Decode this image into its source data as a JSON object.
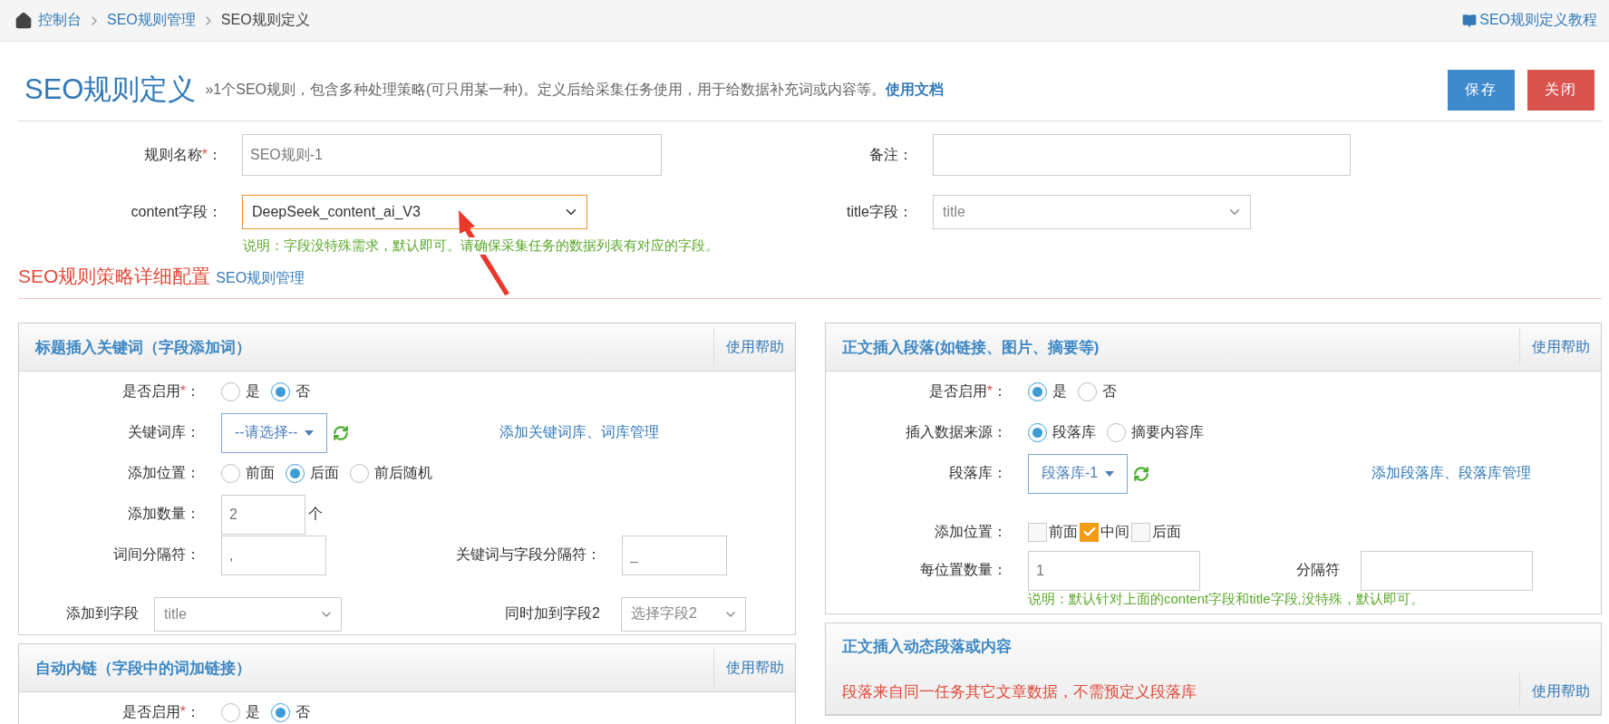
{
  "breadcrumb": {
    "items": [
      {
        "label": "控制台",
        "kind": "home"
      },
      {
        "label": "SEO规则管理",
        "kind": "link"
      },
      {
        "label": "SEO规则定义",
        "kind": "current"
      }
    ],
    "tutorial": "SEO规则定义教程"
  },
  "header": {
    "title": "SEO规则定义",
    "description": "»1个SEO规则，包含多种处理策略(可只用某一种)。定义后给采集任务使用，用于给数据补充词或内容等。",
    "doc_link": "使用文档",
    "buttons": [
      {
        "label": "保存",
        "kind": "primary"
      },
      {
        "label": "关闭",
        "kind": "danger"
      }
    ]
  },
  "form": {
    "rows": [
      [
        {
          "label": "规则名称",
          "star": "*",
          "after": "：",
          "kind": "input",
          "value": "SEO规则-1"
        },
        {
          "label": "备注：",
          "kind": "input"
        }
      ],
      [
        {
          "label": "content字段：",
          "kind": "select",
          "value": "DeepSeek_content_ai_V3",
          "focused": true
        },
        {
          "label": "title字段：",
          "kind": "select",
          "value": "title",
          "focused": false
        }
      ]
    ],
    "hint": "说明：字段没特殊需求，默认即可。请确保采集任务的数据列表有对应的字段。"
  },
  "strategy": {
    "title": "SEO规则策略详细配置",
    "link": "SEO规则管理"
  },
  "columns": [
    [
      {
        "title": "标题插入关键词（字段添加词）",
        "help": "使用帮助",
        "rows": [
          {
            "kind": "radio",
            "label": "是否启用",
            "star": "*",
            "after": "：",
            "options": [
              {
                "label": "是",
                "selected": false
              },
              {
                "label": "否",
                "selected": true
              }
            ]
          },
          {
            "kind": "picker",
            "label": "关键词库：",
            "value": "--请选择--",
            "link": "添加关键词库、词库管理"
          },
          {
            "kind": "radio",
            "label": "添加位置：",
            "options": [
              {
                "label": "前面",
                "selected": false
              },
              {
                "label": "后面",
                "selected": true
              },
              {
                "label": "前后随机",
                "selected": false
              }
            ]
          },
          {
            "kind": "count",
            "label": "添加数量：",
            "value": "2",
            "unit": "个"
          },
          {
            "kind": "pair",
            "label": "词间分隔符：",
            "value": ",",
            "label2": "关键词与字段分隔符：",
            "value2": "_"
          },
          {
            "kind": "selects",
            "label": "添加到字段",
            "value": "title",
            "label2": "同时加到字段2",
            "value2": "选择字段2"
          }
        ]
      },
      {
        "title": "自动内链（字段中的词加链接）",
        "help": "使用帮助",
        "rows": [
          {
            "kind": "radio",
            "label": "是否启用",
            "star": "*",
            "after": "：",
            "options": [
              {
                "label": "是",
                "selected": false
              },
              {
                "label": "否",
                "selected": true
              }
            ]
          }
        ]
      }
    ],
    [
      {
        "title": "正文插入段落(如链接、图片、摘要等)",
        "help": "使用帮助",
        "rows": [
          {
            "kind": "radio",
            "label": "是否启用",
            "star": "*",
            "after": "：",
            "options": [
              {
                "label": "是",
                "selected": true
              },
              {
                "label": "否",
                "selected": false
              }
            ]
          },
          {
            "kind": "radio",
            "label": "插入数据来源：",
            "options": [
              {
                "label": "段落库",
                "selected": true
              },
              {
                "label": "摘要内容库",
                "selected": false
              }
            ]
          },
          {
            "kind": "picker",
            "label": "段落库：",
            "value": "段落库-1",
            "link": "添加段落库、段落库管理"
          },
          {
            "kind": "checks",
            "label": "添加位置：",
            "options": [
              {
                "label": "前面",
                "checked": false
              },
              {
                "label": "中间",
                "checked": true
              },
              {
                "label": "后面",
                "checked": false
              }
            ]
          },
          {
            "kind": "pair",
            "label": "每位置数量：",
            "value": "1",
            "label2": "分隔符"
          },
          {
            "kind": "hint",
            "text": "说明：默认针对上面的content字段和title字段,没特殊，默认即可。"
          }
        ]
      },
      {
        "title": "正文插入动态段落或内容",
        "subtitle": "段落来自同一任务其它文章数据，不需预定义段落库",
        "help": "使用帮助"
      }
    ]
  ]
}
